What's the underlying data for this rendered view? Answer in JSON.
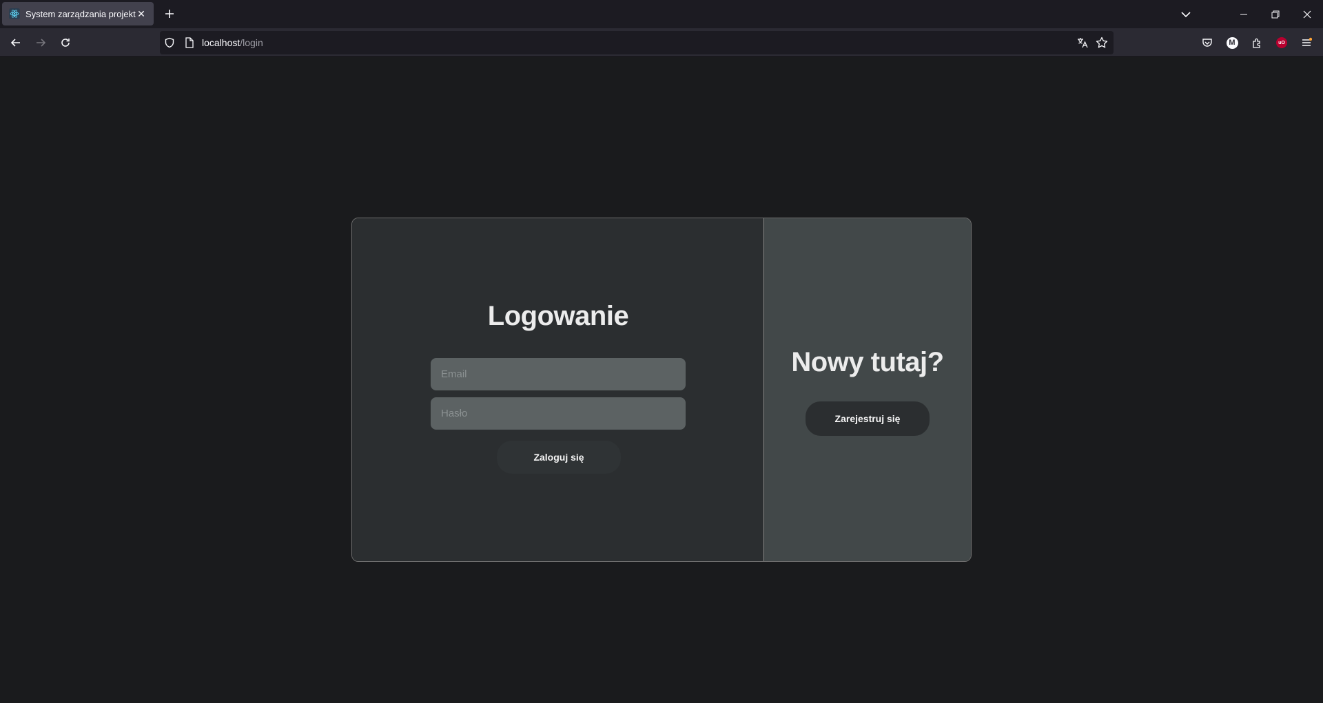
{
  "browser": {
    "tab": {
      "title": "System zarządzania projektami",
      "close_symbol": "✕"
    },
    "new_tab_symbol": "+",
    "url": {
      "host": "localhost",
      "path": "/login"
    },
    "icons": {
      "favicon": "react-icon",
      "back": "back-arrow-icon",
      "forward": "forward-arrow-icon",
      "reload": "reload-icon",
      "shield": "shield-icon",
      "page": "page-icon",
      "translate": "translate-icon",
      "bookmark": "star-icon",
      "pocket": "pocket-icon",
      "account": "account-icon",
      "extensions": "extensions-icon",
      "ublock": "ublock-icon",
      "menu": "menu-icon"
    },
    "account_letter": "M",
    "ublock_label": "uO"
  },
  "login": {
    "title": "Logowanie",
    "email_placeholder": "Email",
    "password_placeholder": "Hasło",
    "submit_label": "Zaloguj się"
  },
  "register": {
    "title": "Nowy tutaj?",
    "button_label": "Zarejestruj się"
  },
  "colors": {
    "page_background": "#1a1b1d",
    "left_panel": "#2b2e30",
    "right_panel": "#424849",
    "input_background": "#5c6263",
    "text": "#ececec"
  }
}
